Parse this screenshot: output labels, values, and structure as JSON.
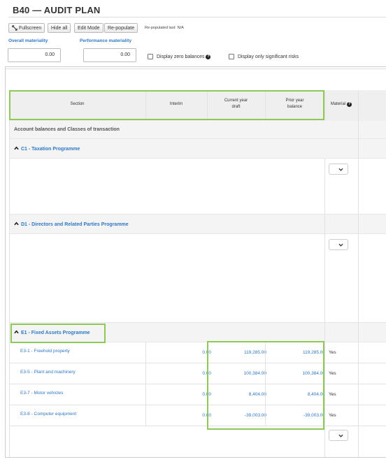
{
  "page": {
    "title": "B40 — AUDIT PLAN"
  },
  "toolbar": {
    "fullscreen": "Fullscreen",
    "hide_all": "Hide all",
    "edit_mode": "Edit Mode",
    "repopulate": "Re-populate",
    "repopulated_label": "Re-populated last:",
    "repopulated_value": "N/A"
  },
  "materiality": {
    "overall_label": "Overall materiality",
    "overall_value": "0.00",
    "performance_label": "Performance materiality",
    "performance_value": "0.00",
    "zero_balances_label": "Display zero balances",
    "significant_risks_label": "Display only significant risks"
  },
  "table": {
    "headers": {
      "section": "Section",
      "interim": "Interim",
      "current_line1": "Current year",
      "current_line2": "draft",
      "prior_line1": "Prior year",
      "prior_line2": "balance",
      "material": "Material"
    },
    "group_title": "Account balances and Classes of transaction",
    "sections": {
      "c1": "C1 - Taxation Programme",
      "d1": "D1 - Directors and Related Parties Programme",
      "e1": "E1 - Fixed Assets Programme"
    },
    "rows": [
      {
        "code": "E3-1 - Freehold property",
        "interim": "0.00",
        "current": "119,285.00",
        "prior": "119,285.00",
        "material": "Yes"
      },
      {
        "code": "E3-5 - Plant and machinery",
        "interim": "0.00",
        "current": "100,384.00",
        "prior": "100,384.00",
        "material": "Yes"
      },
      {
        "code": "E3-7 - Motor vehicles",
        "interim": "0.00",
        "current": "8,404.00",
        "prior": "8,404.00",
        "material": "Yes"
      },
      {
        "code": "E3-8 - Computer equipment",
        "interim": "0.00",
        "current": "-39,003.00",
        "prior": "-39,003.00",
        "material": "Yes"
      }
    ]
  },
  "colors": {
    "link": "#2e78c7",
    "highlight": "#8dc858",
    "band": "#f4f4f4"
  },
  "icons": [
    "expand-arrows-icon",
    "question-circle-icon",
    "chevron-up-icon",
    "chevron-down-icon"
  ]
}
